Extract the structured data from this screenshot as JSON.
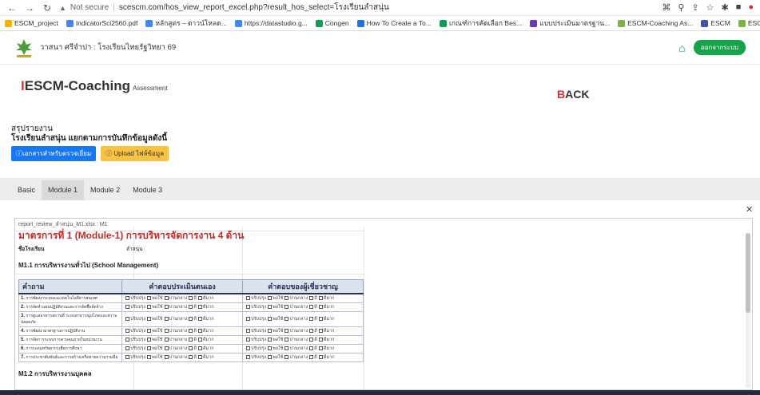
{
  "browser": {
    "security_label": "Not secure",
    "url": "scescm.com/hos_view_report_excel.php?result_hos_select=โรงเรียนลำสนุ่น",
    "bookmarks": [
      {
        "label": "ESCM_project",
        "color": "#f4b400"
      },
      {
        "label": "IndicatorSci2560.pdf",
        "color": "#4285f4"
      },
      {
        "label": "หลักสูตร – ดาวน์โหลด...",
        "color": "#4285f4"
      },
      {
        "label": "https://datastudio.g...",
        "color": "#4285f4"
      },
      {
        "label": "Congen",
        "color": "#0f9d58"
      },
      {
        "label": "How To Create a To...",
        "color": "#1a73e8"
      },
      {
        "label": "เกณฑ์การคัดเลือก Bes...",
        "color": "#0f9d58"
      },
      {
        "label": "แบบประเมินมาตรฐาน...",
        "color": "#673ab7"
      },
      {
        "label": "ESCM-Coaching As...",
        "color": "#7cb342"
      },
      {
        "label": "ESCM",
        "color": "#3f51b5"
      },
      {
        "label": "ESCM-Coaching As...",
        "color": "#7cb342"
      }
    ]
  },
  "header": {
    "school": "วาสนา ศรีจำปา : โรงเรียนไทยรัฐวิทยา 69",
    "logout_label": "ออกจากระบบ"
  },
  "brand": {
    "bar": "I",
    "name": "ESCM-Coaching",
    "sub": "Assessment"
  },
  "back_first": "B",
  "back_rest": "ACK",
  "report": {
    "line1": "สรุปรายงาน",
    "line2": "โรงเรียนลำสนุ่น แยกตามการบันทึกข้อมูลดังนี้",
    "btn_docs": "เอกสารสำหรับตรวจเยี่ยม",
    "btn_upload": "Upload ไฟล์ข้อมูล"
  },
  "tabs": [
    "Basic",
    "Module 1",
    "Module 2",
    "Module 3"
  ],
  "active_tab": 1,
  "sheet": {
    "filename": "report_review_ลำสนุ่น_M1.xlsx : M1",
    "heading": "มาตรการที่ 1 (Module-1) การบริหารจัดการงาน 4 ด้าน",
    "meta_label": "ชื่อโรงเรียน",
    "meta_value": "ลำสนุ่น",
    "section1": "M1.1 การบริหารงานทั่วไป (School Management)",
    "col_question": "คำถาม",
    "col_self": "คำตอบประเมินตนเอง",
    "col_expert": "คำตอบของผู้เชี่ยวชาญ",
    "options": [
      "ปรับปรุง",
      "พอใช้",
      "ปานกลาง",
      "ดี",
      "ดีมาก"
    ],
    "rows": [
      {
        "no": "1.",
        "q": "การพัฒนาระบบและเทคโนโลยีสารสนเทศ"
      },
      {
        "no": "2.",
        "q": "การจัดทำแผนปฏิบัติงานและการจัดซื้อจัดจ้าง"
      },
      {
        "no": "3.",
        "q": "การดูแลอาคารสถานที่ ระบบสาธารณูปโภคและความปลอดภัย"
      },
      {
        "no": "4.",
        "q": "การพัฒนามาตรฐานการปฏิบัติงาน"
      },
      {
        "no": "5.",
        "q": "การจัดการระบบการควบคุมภายในหน่วยงาน"
      },
      {
        "no": "6.",
        "q": "การระดมทรัพยากรเพื่อการศึกษา"
      },
      {
        "no": "7.",
        "q": "การประชาสัมพันธ์และการสร้างเครือข่ายความร่วมมือ"
      }
    ],
    "section2": "M1.2 การบริหารงานบุคคล"
  }
}
